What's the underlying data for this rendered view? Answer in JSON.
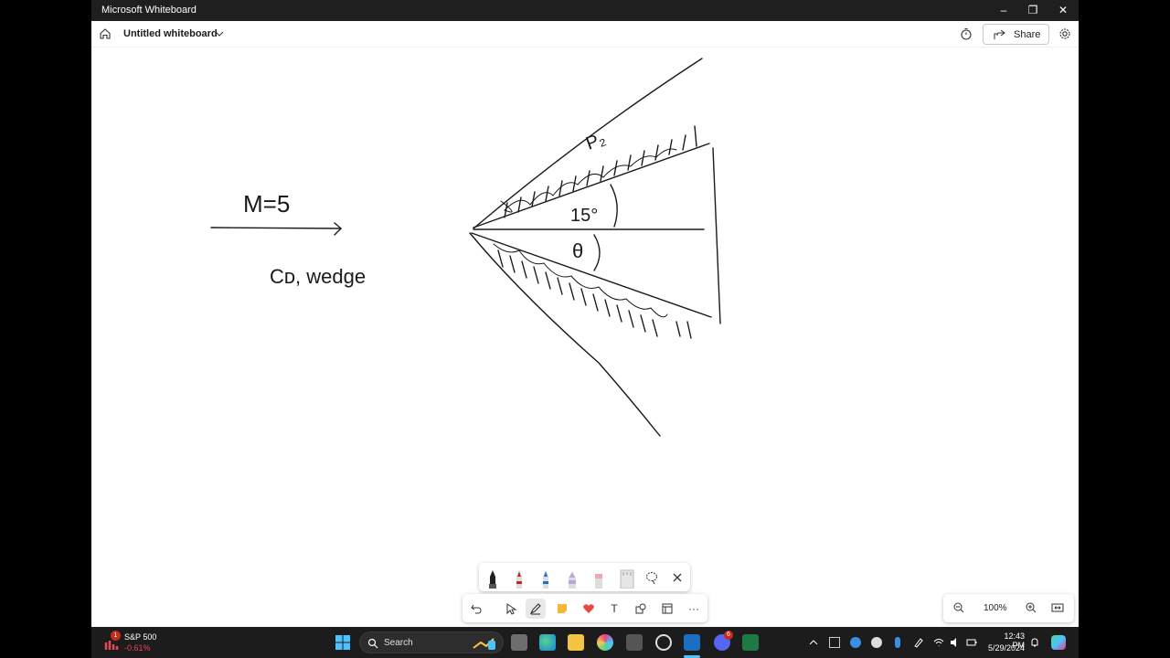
{
  "window": {
    "title": "Microsoft Whiteboard",
    "minimize": "–",
    "restore": "❐",
    "close": "✕"
  },
  "app": {
    "board_title": "Untitled whiteboard",
    "share_label": "Share"
  },
  "canvas": {
    "text_mach": "M=5",
    "text_cd": "Cᴅ, wedge",
    "text_p2": "P₂",
    "text_15": "15°",
    "text_theta": "θ"
  },
  "pens": [
    "black",
    "red",
    "blue",
    "lavender",
    "pink",
    "ruler"
  ],
  "toolbar": {
    "more": "···",
    "text_tool": "T"
  },
  "zoom": {
    "value": "100%"
  },
  "taskbar": {
    "stock_name": "S&P 500",
    "stock_change": "-0.61%",
    "stock_badge": "1",
    "search_placeholder": "Search",
    "discord_badge": "6",
    "time": "12:43 PM",
    "date": "5/29/2024"
  },
  "colors": {
    "accent": "#0078d4",
    "ink": "#1a1a1a",
    "taskbar": "#1c1c1c",
    "stock_down": "#e74856"
  }
}
